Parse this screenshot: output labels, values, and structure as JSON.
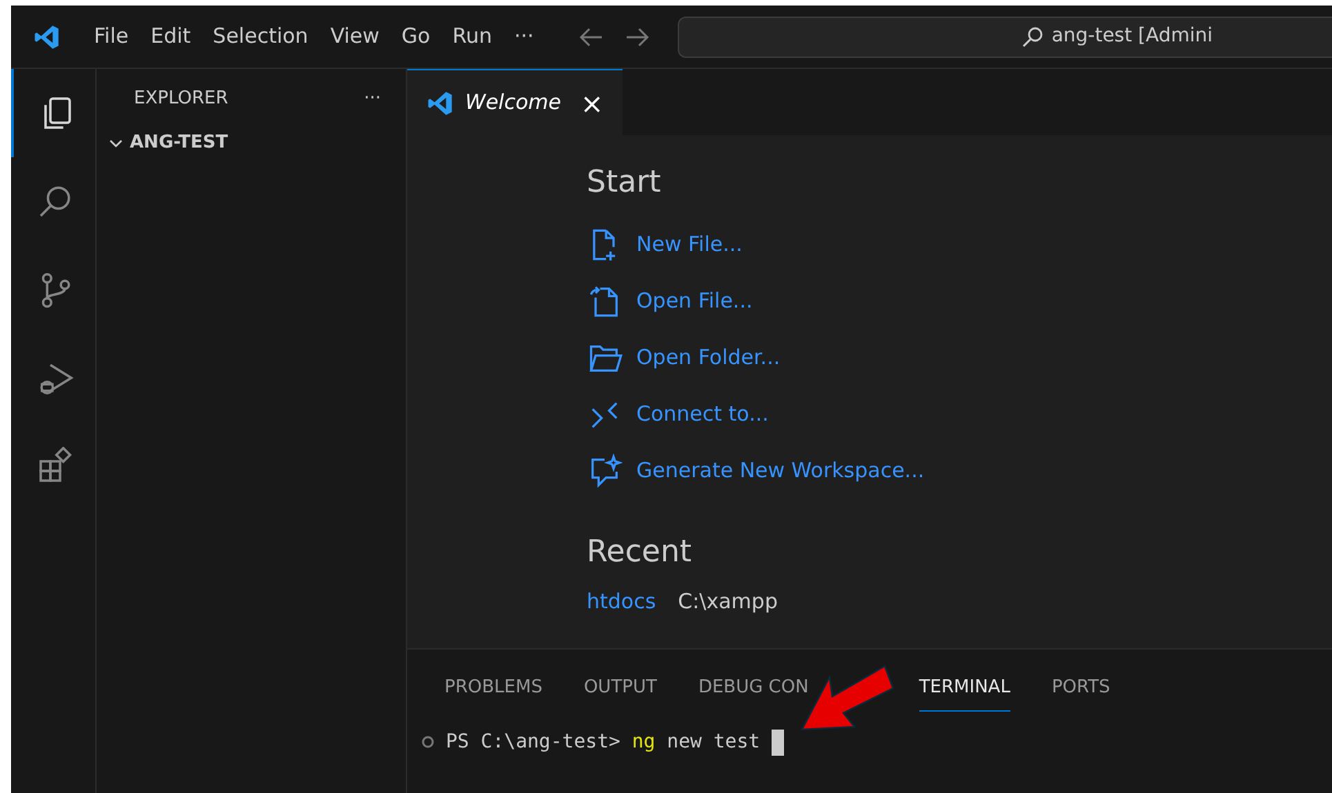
{
  "menu": [
    "File",
    "Edit",
    "Selection",
    "View",
    "Go",
    "Run",
    "···"
  ],
  "command_center": {
    "text": "ang-test [Admini"
  },
  "activity_bar": [
    {
      "kind": "explorer",
      "selected": true
    },
    {
      "kind": "search",
      "selected": false
    },
    {
      "kind": "source-control",
      "selected": false
    },
    {
      "kind": "run-debug",
      "selected": false
    },
    {
      "kind": "extensions",
      "selected": false
    }
  ],
  "sidebar": {
    "title": "EXPLORER",
    "more": "···",
    "folder": {
      "name": "ANG-TEST",
      "expanded": true
    }
  },
  "tabs": [
    {
      "label": "Welcome",
      "close": "×",
      "selected": true
    }
  ],
  "welcome": {
    "start_title": "Start",
    "start": [
      {
        "kind": "new-file",
        "label": "New File..."
      },
      {
        "kind": "open-file",
        "label": "Open File..."
      },
      {
        "kind": "open-folder",
        "label": "Open Folder..."
      },
      {
        "kind": "connect",
        "label": "Connect to..."
      },
      {
        "kind": "generate",
        "label": "Generate New Workspace..."
      }
    ],
    "recent_title": "Recent",
    "recent": [
      {
        "name": "htdocs",
        "path": "C:\\xampp"
      }
    ]
  },
  "panel": {
    "tabs": [
      {
        "label": "PROBLEMS",
        "selected": false
      },
      {
        "label": "OUTPUT",
        "selected": false
      },
      {
        "label": "DEBUG CON",
        "selected": false
      },
      {
        "label": "TERMINAL",
        "selected": true
      },
      {
        "label": "PORTS",
        "selected": false
      }
    ],
    "terminal": {
      "prompt": "PS C:\\ang-test>",
      "command": "ng",
      "args": "new test"
    }
  }
}
